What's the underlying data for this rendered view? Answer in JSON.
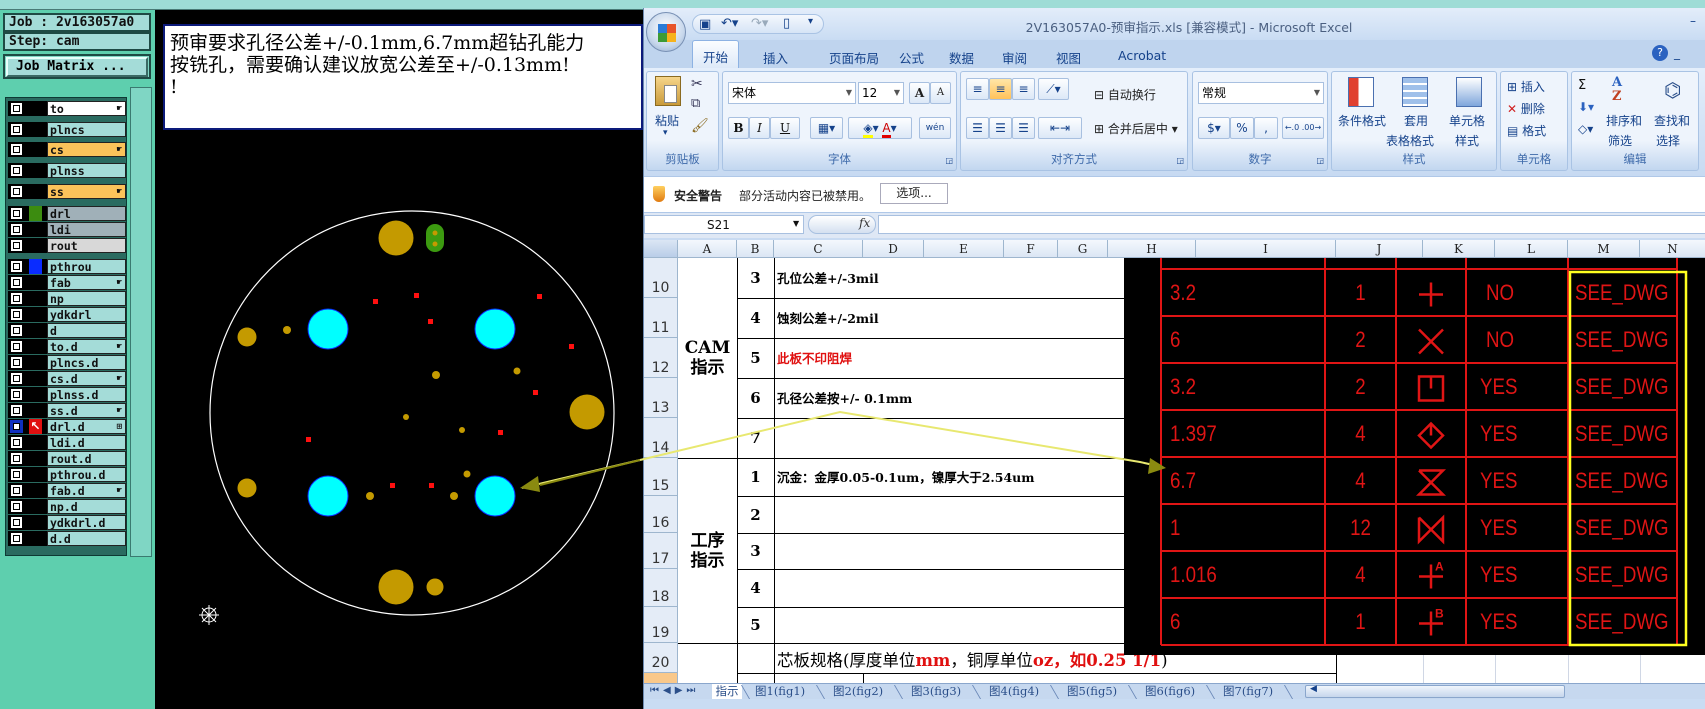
{
  "cam": {
    "job_label": "Job : 2v163057a0",
    "step_label": "Step: cam",
    "job_matrix_button": "Job Matrix ...",
    "layers": [
      {
        "name": "to",
        "bg": "#ffffff",
        "flag": "hand"
      },
      {
        "name": "plncs",
        "bg": "#a4dcd8"
      },
      {
        "name": "cs",
        "bg": "#fbc35a",
        "flag": "hand"
      },
      {
        "name": "plnss",
        "bg": "#a4dcd8"
      },
      {
        "name": "ss",
        "bg": "#fbc35a",
        "flag": "hand"
      },
      {
        "name": "drl",
        "bg": "#a0b0b8",
        "swatch": "#3c8c10"
      },
      {
        "name": "ldi",
        "bg": "#a0b0b8"
      },
      {
        "name": "rout",
        "bg": "#d8d8d8"
      },
      {
        "name": "pthrou",
        "bg": "#a4dcd8",
        "swatch": "#0a2cff"
      },
      {
        "name": "fab",
        "bg": "#a4dcd8",
        "flag": "hand"
      },
      {
        "name": "np",
        "bg": "#a4dcd8"
      },
      {
        "name": "ydkdrl",
        "bg": "#a4dcd8"
      },
      {
        "name": "d",
        "bg": "#a4dcd8"
      },
      {
        "name": "to.d",
        "bg": "#a4dcd8",
        "flag": "hand"
      },
      {
        "name": "plncs.d",
        "bg": "#a4dcd8"
      },
      {
        "name": "cs.d",
        "bg": "#a4dcd8",
        "flag": "hand"
      },
      {
        "name": "plnss.d",
        "bg": "#a4dcd8"
      },
      {
        "name": "ss.d",
        "bg": "#a4dcd8",
        "flag": "hand"
      },
      {
        "name": "drl.d",
        "bg": "#a4dcd8",
        "flag": "grid",
        "swatch": "#e01010",
        "work": true
      },
      {
        "name": "ldi.d",
        "bg": "#a4dcd8"
      },
      {
        "name": "rout.d",
        "bg": "#a4dcd8"
      },
      {
        "name": "pthrou.d",
        "bg": "#a4dcd8"
      },
      {
        "name": "fab.d",
        "bg": "#a4dcd8",
        "flag": "hand"
      },
      {
        "name": "np.d",
        "bg": "#a4dcd8"
      },
      {
        "name": "ydkdrl.d",
        "bg": "#a4dcd8"
      },
      {
        "name": "d.d",
        "bg": "#a4dcd8"
      }
    ],
    "message_lines": [
      "预审要求孔径公差+/-0.1mm,6.7mm超钻孔能力",
      "按铣孔，需要确认建议放宽公差至+/-0.13mm!",
      "!"
    ]
  },
  "excel": {
    "title": "2V163057A0-预审指示.xls  [兼容模式] - Microsoft Excel",
    "tabs": [
      "开始",
      "插入",
      "页面布局",
      "公式",
      "数据",
      "审阅",
      "视图",
      "Acrobat"
    ],
    "active_tab": "开始",
    "ribbon": {
      "clipboard": {
        "label": "剪贴板",
        "paste": "粘贴"
      },
      "font": {
        "label": "字体",
        "font_name": "宋体",
        "font_size": "12",
        "bold": "B",
        "italic": "I",
        "underline": "U",
        "grow": "A",
        "shrink": "A",
        "phonetic": "wén"
      },
      "alignment": {
        "label": "对齐方式",
        "wrap_text": "自动换行",
        "merge_center": "合并后居中"
      },
      "number": {
        "label": "数字",
        "format": "常规",
        "percent": "%",
        "comma": ","
      },
      "styles": {
        "label": "样式",
        "conditional": "条件格式",
        "table_1": "套用",
        "table_2": "表格格式",
        "cell_1": "单元格",
        "cell_2": "样式"
      },
      "cells": {
        "label": "单元格",
        "insert": "插入",
        "delete": "删除",
        "format": "格式"
      },
      "editing": {
        "label": "编辑",
        "sort_1": "排序和",
        "sort_2": "筛选",
        "find_1": "查找和",
        "find_2": "选择",
        "sum": "Σ"
      }
    },
    "security": {
      "title": "安全警告",
      "message": "部分活动内容已被禁用。",
      "options_button": "选项..."
    },
    "name_box": "S21",
    "fx": "fx",
    "columns": [
      "A",
      "B",
      "C",
      "D",
      "E",
      "F",
      "G",
      "H",
      "I",
      "J",
      "K",
      "L",
      "M",
      "N"
    ],
    "cam_section": {
      "label_1": "CAM",
      "label_2": "指示",
      "rows": [
        {
          "row": "10",
          "no": "3",
          "text": "孔位公差+/-3mil"
        },
        {
          "row": "11",
          "no": "4",
          "text": "蚀刻公差+/-2mil"
        },
        {
          "row": "12",
          "no": "5",
          "text": "此板不印阻焊",
          "color": "#e01010"
        },
        {
          "row": "13",
          "no": "6",
          "text": "孔径公差按+/- 0.1mm"
        },
        {
          "row": "14",
          "no": "7",
          "text": ""
        }
      ]
    },
    "process_section": {
      "label_1": "工序",
      "label_2": "指示",
      "rows": [
        {
          "row": "15",
          "no": "1",
          "text": "沉金：金厚0.05-0.1um，镍厚大于2.54um"
        },
        {
          "row": "16",
          "no": "2",
          "text": ""
        },
        {
          "row": "17",
          "no": "3",
          "text": ""
        },
        {
          "row": "18",
          "no": "4",
          "text": ""
        },
        {
          "row": "19",
          "no": "5",
          "text": ""
        }
      ]
    },
    "row20": {
      "row": "20",
      "segments": [
        {
          "t": "芯板规格(厚度单位",
          "c": "#000000"
        },
        {
          "t": "mm",
          "c": "#e01010"
        },
        {
          "t": "，铜厚单位",
          "c": "#000000"
        },
        {
          "t": "oz，如0.25 1/1",
          "c": "#e01010"
        },
        {
          "t": ")",
          "c": "#000000"
        }
      ]
    },
    "drill_table": {
      "rows": [
        {
          "size": "3.2",
          "count": "1",
          "symbol": "plus",
          "plated": "NO",
          "tolerance": "SEE_DWG"
        },
        {
          "size": "6",
          "count": "2",
          "symbol": "cross",
          "plated": "NO",
          "tolerance": "SEE_DWG"
        },
        {
          "size": "3.2",
          "count": "2",
          "symbol": "square-notch",
          "plated": "YES",
          "tolerance": "SEE_DWG"
        },
        {
          "size": "1.397",
          "count": "4",
          "symbol": "diamond-notch",
          "plated": "YES",
          "tolerance": "SEE_DWG"
        },
        {
          "size": "6.7",
          "count": "4",
          "symbol": "hourglass",
          "plated": "YES",
          "tolerance": "SEE_DWG"
        },
        {
          "size": "1",
          "count": "12",
          "symbol": "bowtie",
          "plated": "YES",
          "tolerance": "SEE_DWG"
        },
        {
          "size": "1.016",
          "count": "4",
          "symbol": "plus-A",
          "plated": "YES",
          "tolerance": "SEE_DWG"
        },
        {
          "size": "6",
          "count": "1",
          "symbol": "plus-B",
          "plated": "YES",
          "tolerance": "SEE_DWG"
        }
      ]
    },
    "sheet_tabs": [
      "指示",
      "图1(fig1)",
      "图2(fig2)",
      "图3(fig3)",
      "图4(fig4)",
      "图5(fig5)",
      "图6(fig6)",
      "图7(fig7)"
    ],
    "active_sheet": "指示"
  },
  "colors": {
    "drill_red": "#e01515",
    "highlight_yellow": "#ffff20",
    "annotation": "#e8e870",
    "copper": "#c49a00",
    "via_cyan": "#00ffff"
  }
}
